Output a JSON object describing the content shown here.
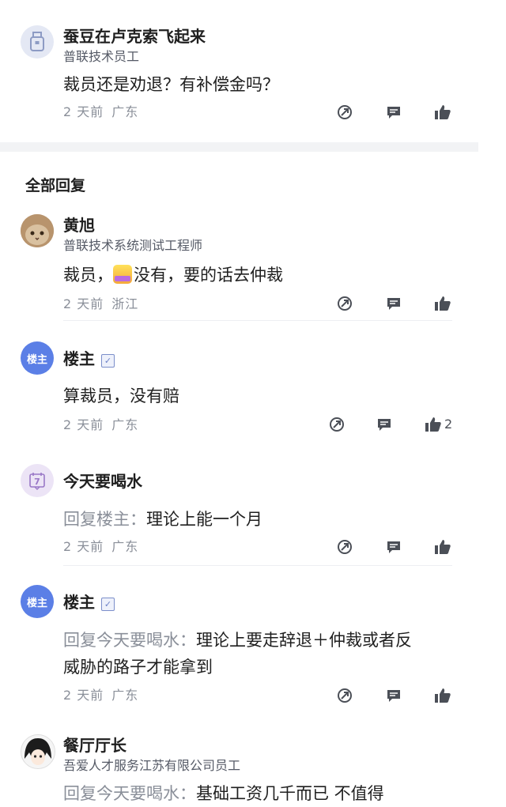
{
  "post": {
    "author": "蚕豆在卢克索飞起来",
    "role": "普联技术员工",
    "content": "裁员还是劝退？有补偿金吗？",
    "time": "2 天前",
    "location": "广东"
  },
  "replies_title": "全部回复",
  "replies": [
    {
      "author": "黄旭",
      "role": "普联技术系统测试工程师",
      "content_before": "裁员，",
      "content_after": "没有，要的话去仲裁",
      "time": "2 天前",
      "location": "浙江"
    },
    {
      "author": "楼主",
      "avatar_text": "楼主",
      "content": "算裁员，没有赔",
      "time": "2 天前",
      "location": "广东",
      "likes": "2"
    },
    {
      "author": "今天要喝水",
      "avatar_text": "7",
      "reply_prefix": "回复楼主：",
      "content": "理论上能一个月",
      "time": "2 天前",
      "location": "广东"
    },
    {
      "author": "楼主",
      "avatar_text": "楼主",
      "reply_prefix": "回复今天要喝水：",
      "content_line1": "理论上要走辞退＋仲裁或者反",
      "content_line2": "威胁的路子才能拿到",
      "time": "2 天前",
      "location": "广东"
    },
    {
      "author": "餐厅厅长",
      "role": "吾爱人才服务江苏有限公司员工",
      "reply_prefix": "回复今天要喝水：",
      "content": "基础工资几千而已 不值得"
    }
  ],
  "icons": {
    "share": "share-icon",
    "comment": "comment-icon",
    "like": "thumbs-up-icon",
    "verified": "verified-icon"
  },
  "colors": {
    "owner_badge": "#5b7fe6",
    "secondary_text": "#8a8f99",
    "separator": "#f2f3f5"
  }
}
